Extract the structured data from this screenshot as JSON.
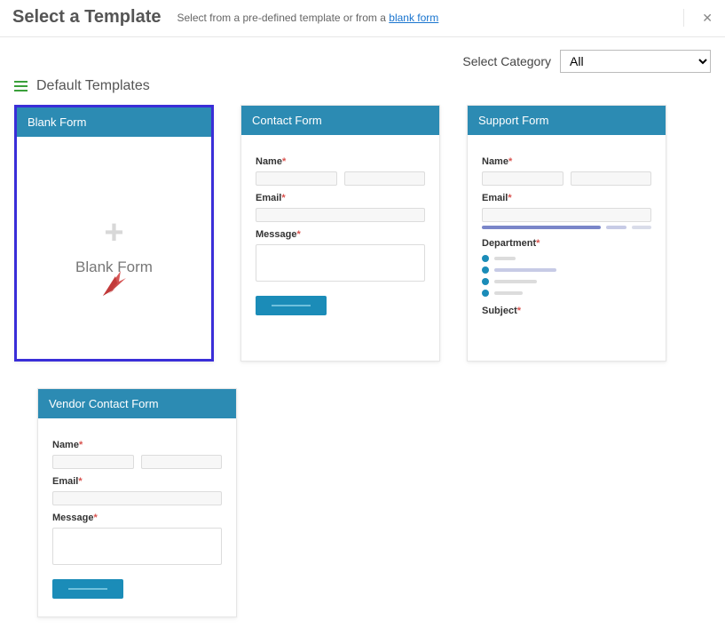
{
  "header": {
    "title": "Select a Template",
    "subtitle_pre": "Select from a pre-defined template or from a ",
    "subtitle_link": "blank form"
  },
  "category": {
    "label": "Select Category",
    "selected": "All"
  },
  "section": {
    "title": "Default Templates"
  },
  "cards": {
    "blank": {
      "title": "Blank Form",
      "body_label": "Blank Form"
    },
    "contact": {
      "title": "Contact Form",
      "fields": {
        "name": "Name",
        "email": "Email",
        "message": "Message"
      }
    },
    "support": {
      "title": "Support Form",
      "fields": {
        "name": "Name",
        "email": "Email",
        "department": "Department",
        "subject": "Subject"
      }
    },
    "vendor": {
      "title": "Vendor Contact Form",
      "fields": {
        "name": "Name",
        "email": "Email",
        "message": "Message"
      }
    }
  },
  "required_mark": "*"
}
